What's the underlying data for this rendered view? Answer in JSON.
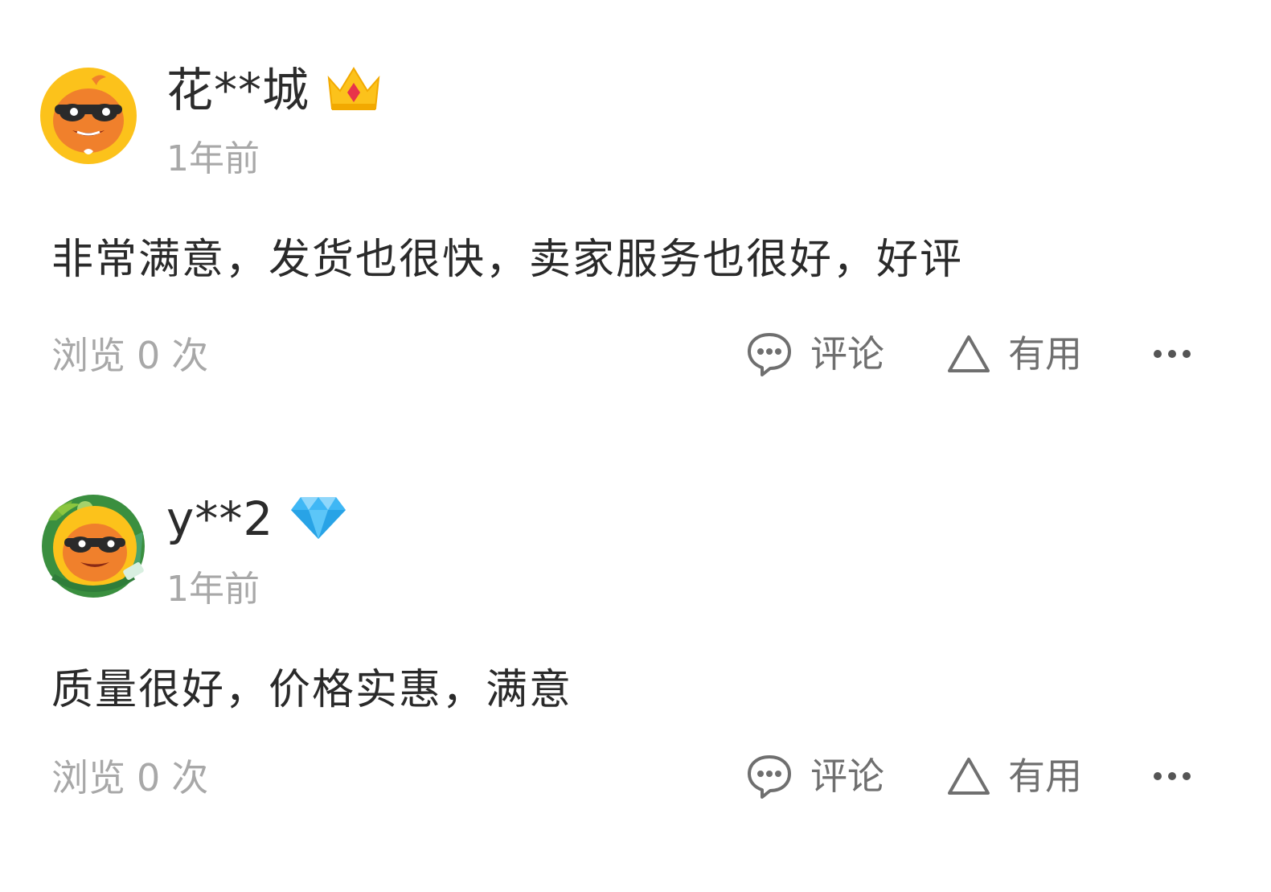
{
  "reviews": [
    {
      "nickname": "花**城",
      "badge": "crown-icon",
      "time": "1年前",
      "content": "非常满意，发货也很快，卖家服务也很好，好评",
      "views_prefix": "浏览",
      "views_count": "0",
      "views_suffix": "次",
      "comment_label": "评论",
      "useful_label": "有用"
    },
    {
      "nickname": "y**2",
      "badge": "diamond-icon",
      "time": "1年前",
      "content": "质量很好，价格实惠，满意",
      "views_prefix": "浏览",
      "views_count": "0",
      "views_suffix": "次",
      "comment_label": "评论",
      "useful_label": "有用"
    }
  ],
  "colors": {
    "text_primary": "#2b2b2b",
    "text_secondary": "#a8a8a8",
    "action_text": "#6f6f6f",
    "avatar_orange": "#f0802c",
    "avatar_yellow": "#fcc21b",
    "diamond_blue": "#3fb7f5"
  }
}
